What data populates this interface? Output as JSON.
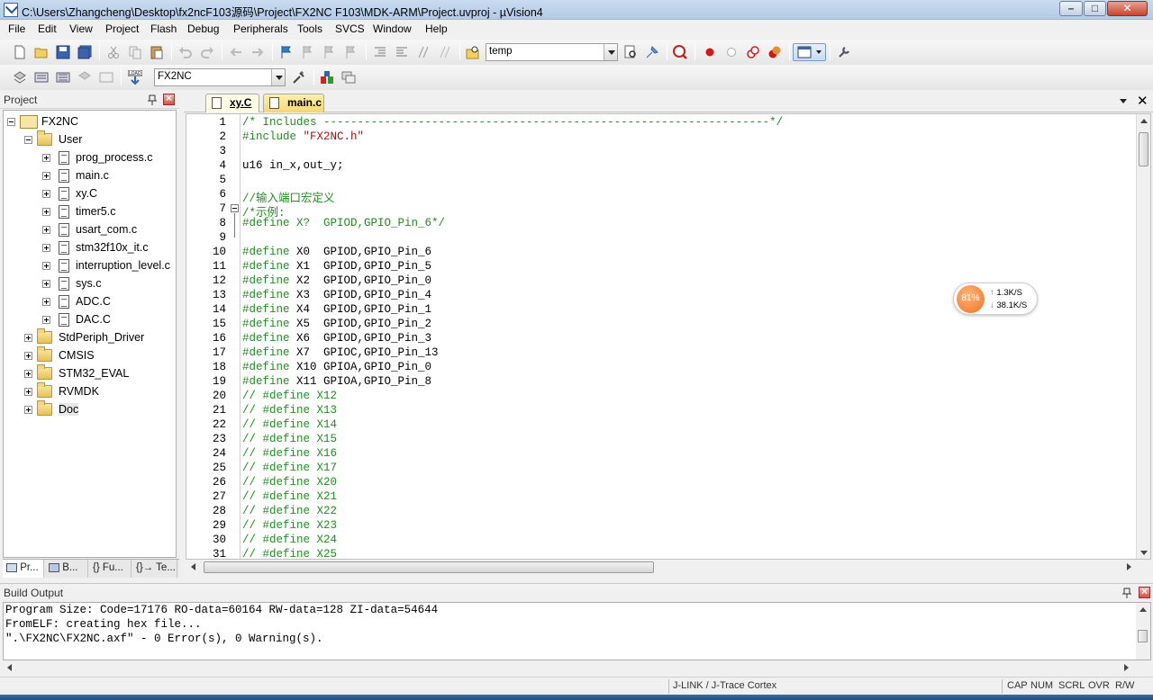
{
  "window": {
    "title": "C:\\Users\\Zhangcheng\\Desktop\\fx2ncF103源码\\Project\\FX2NC F103\\MDK-ARM\\Project.uvproj - µVision4"
  },
  "menu": [
    "File",
    "Edit",
    "View",
    "Project",
    "Flash",
    "Debug",
    "Peripherals",
    "Tools",
    "SVCS",
    "Window",
    "Help"
  ],
  "toolbar": {
    "find_combo_value": "temp",
    "target_combo_value": "FX2NC"
  },
  "project_panel": {
    "title": "Project",
    "root": "FX2NC",
    "groups": [
      {
        "name": "User",
        "expanded": true,
        "files": [
          "prog_process.c",
          "main.c",
          "xy.C",
          "timer5.c",
          "usart_com.c",
          "stm32f10x_it.c",
          "interruption_level.c",
          "sys.c",
          "ADC.C",
          "DAC.C"
        ]
      },
      {
        "name": "StdPeriph_Driver"
      },
      {
        "name": "CMSIS"
      },
      {
        "name": "STM32_EVAL"
      },
      {
        "name": "RVMDK"
      },
      {
        "name": "Doc"
      }
    ],
    "tabs": [
      "Pr...",
      "B...",
      "{} Fu...",
      "{}→ Te..."
    ]
  },
  "editor": {
    "tabs": [
      {
        "label": "xy.C",
        "active": true
      },
      {
        "label": "main.c",
        "active": false
      }
    ],
    "lines": [
      {
        "n": "1",
        "text": "/* Includes ------------------------------------------------------------------*/",
        "kind": "comment"
      },
      {
        "n": "2",
        "text": "#include \"FX2NC.h\"",
        "kind": "include"
      },
      {
        "n": "3",
        "text": "",
        "kind": "plain"
      },
      {
        "n": "4",
        "text": "u16 in_x,out_y;",
        "kind": "plain"
      },
      {
        "n": "5",
        "text": "",
        "kind": "plain"
      },
      {
        "n": "6",
        "text": "//输入端口宏定义",
        "kind": "comment"
      },
      {
        "n": "7",
        "text": "/*示例:",
        "kind": "comment"
      },
      {
        "n": "8",
        "text": "#define X?  GPIOD,GPIO_Pin_6*/",
        "kind": "comment"
      },
      {
        "n": "9",
        "text": "",
        "kind": "plain"
      },
      {
        "n": "10",
        "text": "#define X0  GPIOD,GPIO_Pin_6",
        "kind": "define"
      },
      {
        "n": "11",
        "text": "#define X1  GPIOD,GPIO_Pin_5",
        "kind": "define"
      },
      {
        "n": "12",
        "text": "#define X2  GPIOD,GPIO_Pin_0",
        "kind": "define"
      },
      {
        "n": "13",
        "text": "#define X3  GPIOD,GPIO_Pin_4",
        "kind": "define"
      },
      {
        "n": "14",
        "text": "#define X4  GPIOD,GPIO_Pin_1",
        "kind": "define"
      },
      {
        "n": "15",
        "text": "#define X5  GPIOD,GPIO_Pin_2",
        "kind": "define"
      },
      {
        "n": "16",
        "text": "#define X6  GPIOD,GPIO_Pin_3",
        "kind": "define"
      },
      {
        "n": "17",
        "text": "#define X7  GPIOC,GPIO_Pin_13",
        "kind": "define"
      },
      {
        "n": "18",
        "text": "#define X10 GPIOA,GPIO_Pin_0",
        "kind": "define"
      },
      {
        "n": "19",
        "text": "#define X11 GPIOA,GPIO_Pin_8",
        "kind": "define"
      },
      {
        "n": "20",
        "text": "// #define X12",
        "kind": "comment"
      },
      {
        "n": "21",
        "text": "// #define X13",
        "kind": "comment"
      },
      {
        "n": "22",
        "text": "// #define X14",
        "kind": "comment"
      },
      {
        "n": "23",
        "text": "// #define X15",
        "kind": "comment"
      },
      {
        "n": "24",
        "text": "// #define X16",
        "kind": "comment"
      },
      {
        "n": "25",
        "text": "// #define X17",
        "kind": "comment"
      },
      {
        "n": "26",
        "text": "// #define X20",
        "kind": "comment"
      },
      {
        "n": "27",
        "text": "// #define X21",
        "kind": "comment"
      },
      {
        "n": "28",
        "text": "// #define X22",
        "kind": "comment"
      },
      {
        "n": "29",
        "text": "// #define X23",
        "kind": "comment"
      },
      {
        "n": "30",
        "text": "// #define X24",
        "kind": "comment"
      },
      {
        "n": "31",
        "text": "// #define X25",
        "kind": "comment"
      }
    ]
  },
  "net_widget": {
    "percent": "81%",
    "up": "1.3K/S",
    "down": "38.1K/S"
  },
  "build_output": {
    "title": "Build Output",
    "lines": [
      "Program Size: Code=17176 RO-data=60164 RW-data=128 ZI-data=54644",
      "FromELF: creating hex file...",
      "\".\\FX2NC\\FX2NC.axf\" - 0 Error(s), 0 Warning(s)."
    ]
  },
  "status_bar": {
    "debugger": "J-LINK / J-Trace Cortex",
    "indicators": [
      "CAP",
      "NUM",
      "SCRL",
      "OVR",
      "R/W"
    ]
  },
  "colors": {
    "comment": "#228b22",
    "string": "#a31515",
    "titlebar": "#b4cbe6"
  }
}
